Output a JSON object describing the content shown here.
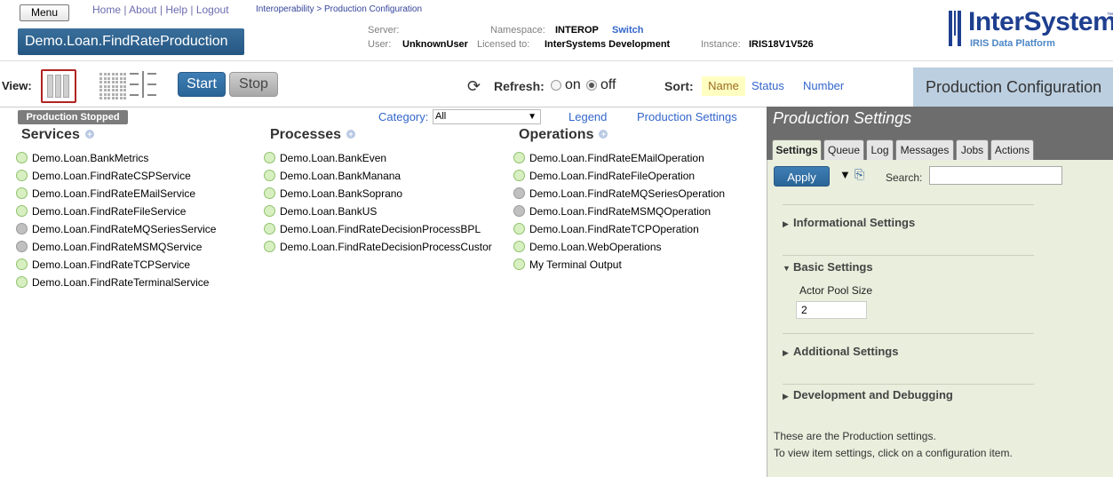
{
  "header": {
    "menu_label": "Menu",
    "links": [
      "Home",
      "About",
      "Help",
      "Logout"
    ],
    "link_sep": "|",
    "breadcrumb": "Interoperability > Production Configuration",
    "production_name": "Demo.Loan.FindRateProduction",
    "server_label": "Server:",
    "user_label": "User:",
    "user_value": "UnknownUser",
    "namespace_label": "Namespace:",
    "namespace_value": "INTEROP",
    "switch_label": "Switch",
    "licensed_label": "Licensed to:",
    "licensed_value": "InterSystems Development",
    "instance_label": "Instance:",
    "instance_value": "IRIS18V1V526",
    "logo_text": "InterSystems",
    "logo_tm": "™",
    "logo_sub": "IRIS Data Platform"
  },
  "toolbar": {
    "view_label": "View:",
    "start_label": "Start",
    "stop_label": "Stop",
    "refresh_label": "Refresh:",
    "refresh_on": "on",
    "refresh_off": "off",
    "refresh_selected": "off",
    "sort_label": "Sort:",
    "sort_name": "Name",
    "sort_status": "Status",
    "sort_number": "Number",
    "page_title": "Production Configuration"
  },
  "main": {
    "status_badge": "Production Stopped",
    "category_label": "Category:",
    "category_value": "All",
    "legend_label": "Legend",
    "prod_settings_label": "Production Settings",
    "services_header": "Services",
    "processes_header": "Processes",
    "operations_header": "Operations",
    "services": [
      {
        "name": "Demo.Loan.BankMetrics",
        "status": "green"
      },
      {
        "name": "Demo.Loan.FindRateCSPService",
        "status": "green"
      },
      {
        "name": "Demo.Loan.FindRateEMailService",
        "status": "green"
      },
      {
        "name": "Demo.Loan.FindRateFileService",
        "status": "green"
      },
      {
        "name": "Demo.Loan.FindRateMQSeriesService",
        "status": "grey"
      },
      {
        "name": "Demo.Loan.FindRateMSMQService",
        "status": "grey"
      },
      {
        "name": "Demo.Loan.FindRateTCPService",
        "status": "green"
      },
      {
        "name": "Demo.Loan.FindRateTerminalService",
        "status": "green"
      }
    ],
    "processes": [
      {
        "name": "Demo.Loan.BankEven",
        "status": "green"
      },
      {
        "name": "Demo.Loan.BankManana",
        "status": "green"
      },
      {
        "name": "Demo.Loan.BankSoprano",
        "status": "green"
      },
      {
        "name": "Demo.Loan.BankUS",
        "status": "green"
      },
      {
        "name": "Demo.Loan.FindRateDecisionProcessBPL",
        "status": "green"
      },
      {
        "name": "Demo.Loan.FindRateDecisionProcessCustor",
        "status": "green"
      }
    ],
    "operations": [
      {
        "name": "Demo.Loan.FindRateEMailOperation",
        "status": "green"
      },
      {
        "name": "Demo.Loan.FindRateFileOperation",
        "status": "green"
      },
      {
        "name": "Demo.Loan.FindRateMQSeriesOperation",
        "status": "grey"
      },
      {
        "name": "Demo.Loan.FindRateMSMQOperation",
        "status": "grey"
      },
      {
        "name": "Demo.Loan.FindRateTCPOperation",
        "status": "green"
      },
      {
        "name": "Demo.Loan.WebOperations",
        "status": "green"
      },
      {
        "name": "My Terminal Output",
        "status": "green"
      }
    ]
  },
  "panel": {
    "title": "Production Settings",
    "tabs": [
      "Settings",
      "Queue",
      "Log",
      "Messages",
      "Jobs",
      "Actions"
    ],
    "active_tab": "Settings",
    "apply_label": "Apply",
    "search_label": "Search:",
    "search_value": "",
    "sections": [
      {
        "title": "Informational Settings",
        "expanded": false
      },
      {
        "title": "Basic Settings",
        "expanded": true
      },
      {
        "title": "Additional Settings",
        "expanded": false
      },
      {
        "title": "Development and Debugging",
        "expanded": false
      }
    ],
    "actor_pool_label": "Actor Pool Size",
    "actor_pool_value": "2",
    "note_line1": "These are the Production settings.",
    "note_line2": "To view item settings, click on a configuration item."
  },
  "colors": {
    "accent_blue": "#2a6597",
    "link_blue": "#3366cc",
    "status_green": "#d8efc2",
    "status_grey": "#c0c0c0",
    "panel_bg": "#e9eedd"
  }
}
